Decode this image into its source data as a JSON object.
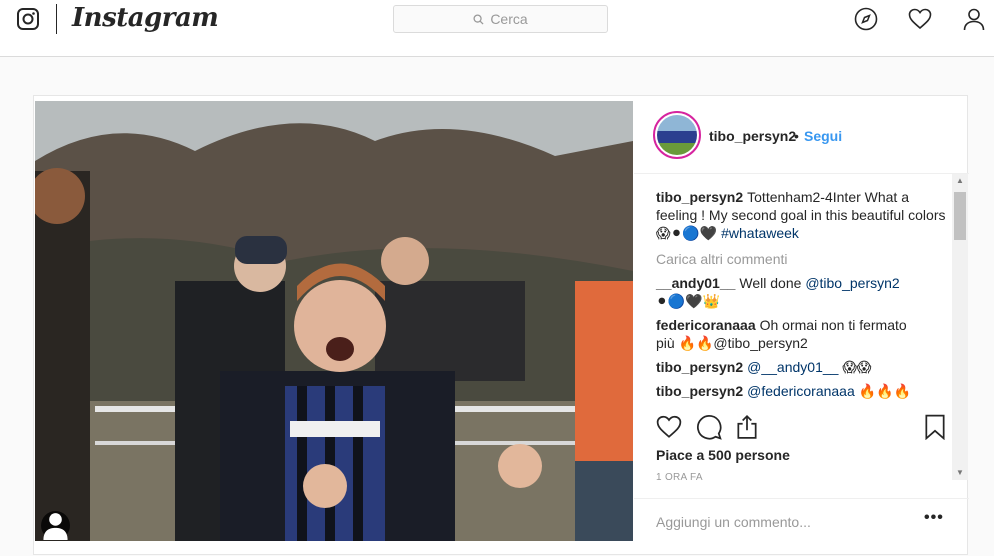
{
  "nav": {
    "wordmark": "Instagram",
    "search_placeholder": "Cerca"
  },
  "post": {
    "username": "tibo_persyn2",
    "dot": "•",
    "follow_label": "Segui",
    "caption": {
      "username": "tibo_persyn2",
      "text": "Tottenham2-4Inter What a feeling ! My second goal in this beautiful colors 😱⚫🔵🖤",
      "hashtag": "#whataweek"
    },
    "load_more": "Carica altri commenti",
    "comments": [
      {
        "username": "__andy01__",
        "text": "Well done",
        "mention": "@tibo_persyn2",
        "after": "⚫🔵🖤👑"
      },
      {
        "username": "federicoranaaa",
        "text": "Oh ormai non ti fermato più 🔥🔥@tibo_persyn2",
        "mention": "",
        "after": ""
      },
      {
        "username": "tibo_persyn2",
        "text": "",
        "mention": "@__andy01__",
        "after": "😱😱"
      },
      {
        "username": "tibo_persyn2",
        "text": "",
        "mention": "@federicoranaaa",
        "after": "🔥🔥🔥"
      }
    ],
    "likes": "Piace a 500 persone",
    "time": "1 ORA FA",
    "add_comment_placeholder": "Aggiungi un commento...",
    "more_label": "•••"
  },
  "colors": {
    "accent_blue": "#3897f0",
    "border": "#dbdbdb",
    "text": "#262626"
  }
}
